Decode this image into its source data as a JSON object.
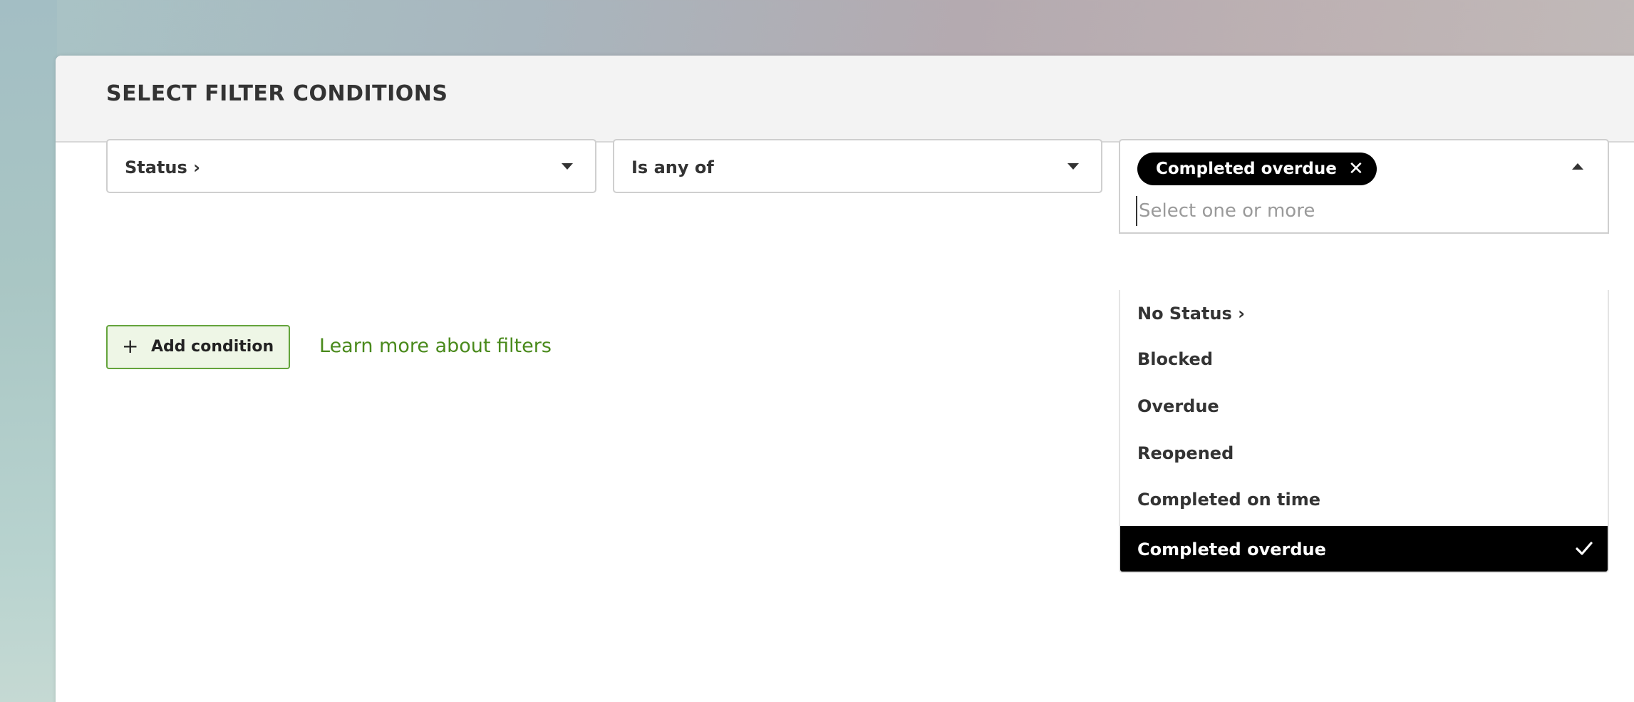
{
  "panel": {
    "title": "SELECT FILTER CONDITIONS"
  },
  "condition": {
    "field": {
      "label": "Status ›",
      "icon": "caret-down-icon"
    },
    "operator": {
      "label": "Is any of",
      "icon": "caret-down-icon"
    },
    "value_select": {
      "selected_chips": [
        "Completed overdue"
      ],
      "chip_remove_icon": "close-icon",
      "placeholder": "Select one or more",
      "value": "",
      "toggle_icon": "caret-up-icon",
      "open": true,
      "options": [
        {
          "label": "No Status ›",
          "selected": false
        },
        {
          "label": "Blocked",
          "selected": false
        },
        {
          "label": "Overdue",
          "selected": false
        },
        {
          "label": "Reopened",
          "selected": false
        },
        {
          "label": "Completed on time",
          "selected": false
        },
        {
          "label": "Completed overdue",
          "selected": true,
          "icon": "check-icon"
        }
      ]
    }
  },
  "actions": {
    "add_condition_label": "Add condition",
    "add_condition_icon": "plus-icon",
    "learn_more_label": "Learn more about filters"
  },
  "colors": {
    "accent_green": "#64a43c",
    "link_green": "#4a8a1c",
    "selected_bg": "#000000"
  }
}
